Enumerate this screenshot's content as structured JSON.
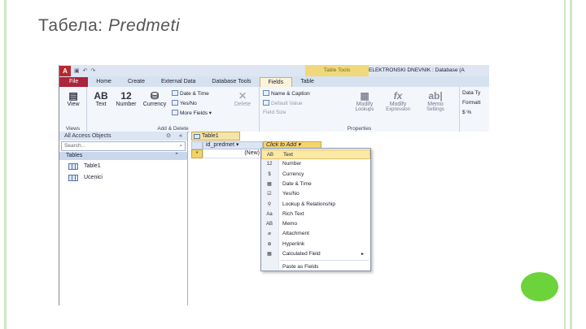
{
  "slide": {
    "title_prefix": "Табела: ",
    "title_name": "Predmeti",
    "accent_color": "#6cd33a"
  },
  "app": {
    "logo": "A",
    "context_tab_group": "Table Tools",
    "window_title": "ELEKTRONSKI DNEVNIK : Database (A"
  },
  "tabs": [
    "File",
    "Home",
    "Create",
    "External Data",
    "Database Tools",
    "Fields",
    "Table"
  ],
  "ribbon": {
    "views": {
      "view_label": "View",
      "group": "Views"
    },
    "add_delete": {
      "text_label": "Text",
      "text_glyph": "AB",
      "number_label": "Number",
      "number_glyph": "12",
      "currency_label": "Currency",
      "date_time": "Date & Time",
      "yes_no": "Yes/No",
      "more_fields": "More Fields",
      "delete": "Delete",
      "group": "Add & Delete"
    },
    "properties": {
      "name_caption": "Name & Caption",
      "default_value": "Default Value",
      "field_size": "Field Size",
      "modify_lookups": "Modify",
      "modify_lookups_sub": "Lookups",
      "modify_expression": "Modify",
      "modify_expression_sub": "Expression",
      "memo": "Memo",
      "memo_sub": "Settings",
      "group": "Properties"
    },
    "formatting": {
      "data_type": "Data Ty",
      "format": "Formatt",
      "symbols": "$ %"
    }
  },
  "nav_pane": {
    "header": "All Access Objects",
    "search_placeholder": "Search...",
    "section": "Tables",
    "items": [
      "Table1",
      "Ucenici"
    ]
  },
  "document": {
    "tab": "Table1",
    "columns": [
      "id_predmet",
      "Click to Add"
    ],
    "new_row_marker": "*",
    "new_row_value": "(New)"
  },
  "dropdown": {
    "items": [
      {
        "icon": "AB",
        "label": "Text"
      },
      {
        "icon": "12",
        "label": "Number"
      },
      {
        "icon": "$",
        "label": "Currency"
      },
      {
        "icon": "▦",
        "label": "Date & Time"
      },
      {
        "icon": "☑",
        "label": "Yes/No"
      },
      {
        "icon": "⚲",
        "label": "Lookup & Relationship"
      },
      {
        "icon": "Aa",
        "label": "Rich Text"
      },
      {
        "icon": "AB",
        "label": "Memo"
      },
      {
        "icon": "⌀",
        "label": "Attachment"
      },
      {
        "icon": "⊕",
        "label": "Hyperlink"
      },
      {
        "icon": "▦",
        "label": "Calculated Field"
      },
      {
        "icon": "",
        "label": "Paste as Fields"
      }
    ]
  }
}
